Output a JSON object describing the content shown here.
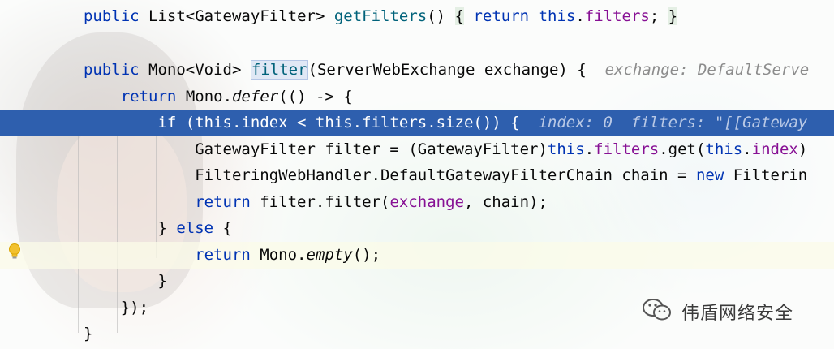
{
  "code": {
    "line1": {
      "modifier": "public",
      "type": "List<GatewayFilter>",
      "method": "getFilters",
      "parens": "()",
      "open_brace": "{",
      "return_kw": "return",
      "this_kw": "this",
      "dot": ".",
      "field": "filters",
      "semi": ";",
      "close_brace": "}"
    },
    "line2": {
      "modifier": "public",
      "type": "Mono<Void>",
      "method": "filter",
      "params": "(ServerWebExchange exchange) {",
      "hint": "exchange: DefaultServe"
    },
    "line3": {
      "return_kw": "return",
      "call_prefix": "Mono.",
      "defer": "defer",
      "rest": "(() -> {"
    },
    "line4": {
      "text": "if (this.index < this.filters.size()) {",
      "hint": "index: 0  filters: \"[[Gateway"
    },
    "line5": {
      "type_decl": "GatewayFilter filter = (GatewayFilter)",
      "this1": "this",
      "dot1": ".",
      "field1": "filters",
      "get": ".get(",
      "this2": "this",
      "dot2": ".",
      "field2": "index",
      "end": ")"
    },
    "line6": {
      "decl": "FilteringWebHandler.DefaultGatewayFilterChain chain = ",
      "new_kw": "new",
      "rest": " Filterin"
    },
    "line7": {
      "return_kw": "return",
      "call": " filter.filter(",
      "arg1": "exchange",
      "rest": ", chain);"
    },
    "line8": {
      "close": "} ",
      "else_kw": "else",
      "open": " {"
    },
    "line9": {
      "return_kw": "return",
      "call_prefix": " Mono.",
      "empty": "empty",
      "rest": "();"
    },
    "line10": {
      "text": "}"
    },
    "line11": {
      "text": "});"
    },
    "line12": {
      "text": "}"
    }
  },
  "watermark": {
    "icon": "wechat-icon",
    "text": "伟盾网络安全"
  },
  "gutter": {
    "icon": "lightbulb-icon"
  },
  "colors": {
    "keyword": "#0033b3",
    "field": "#871094",
    "method": "#00627a",
    "execution_line": "#2e5fae",
    "hint": "#8c8c8c"
  }
}
